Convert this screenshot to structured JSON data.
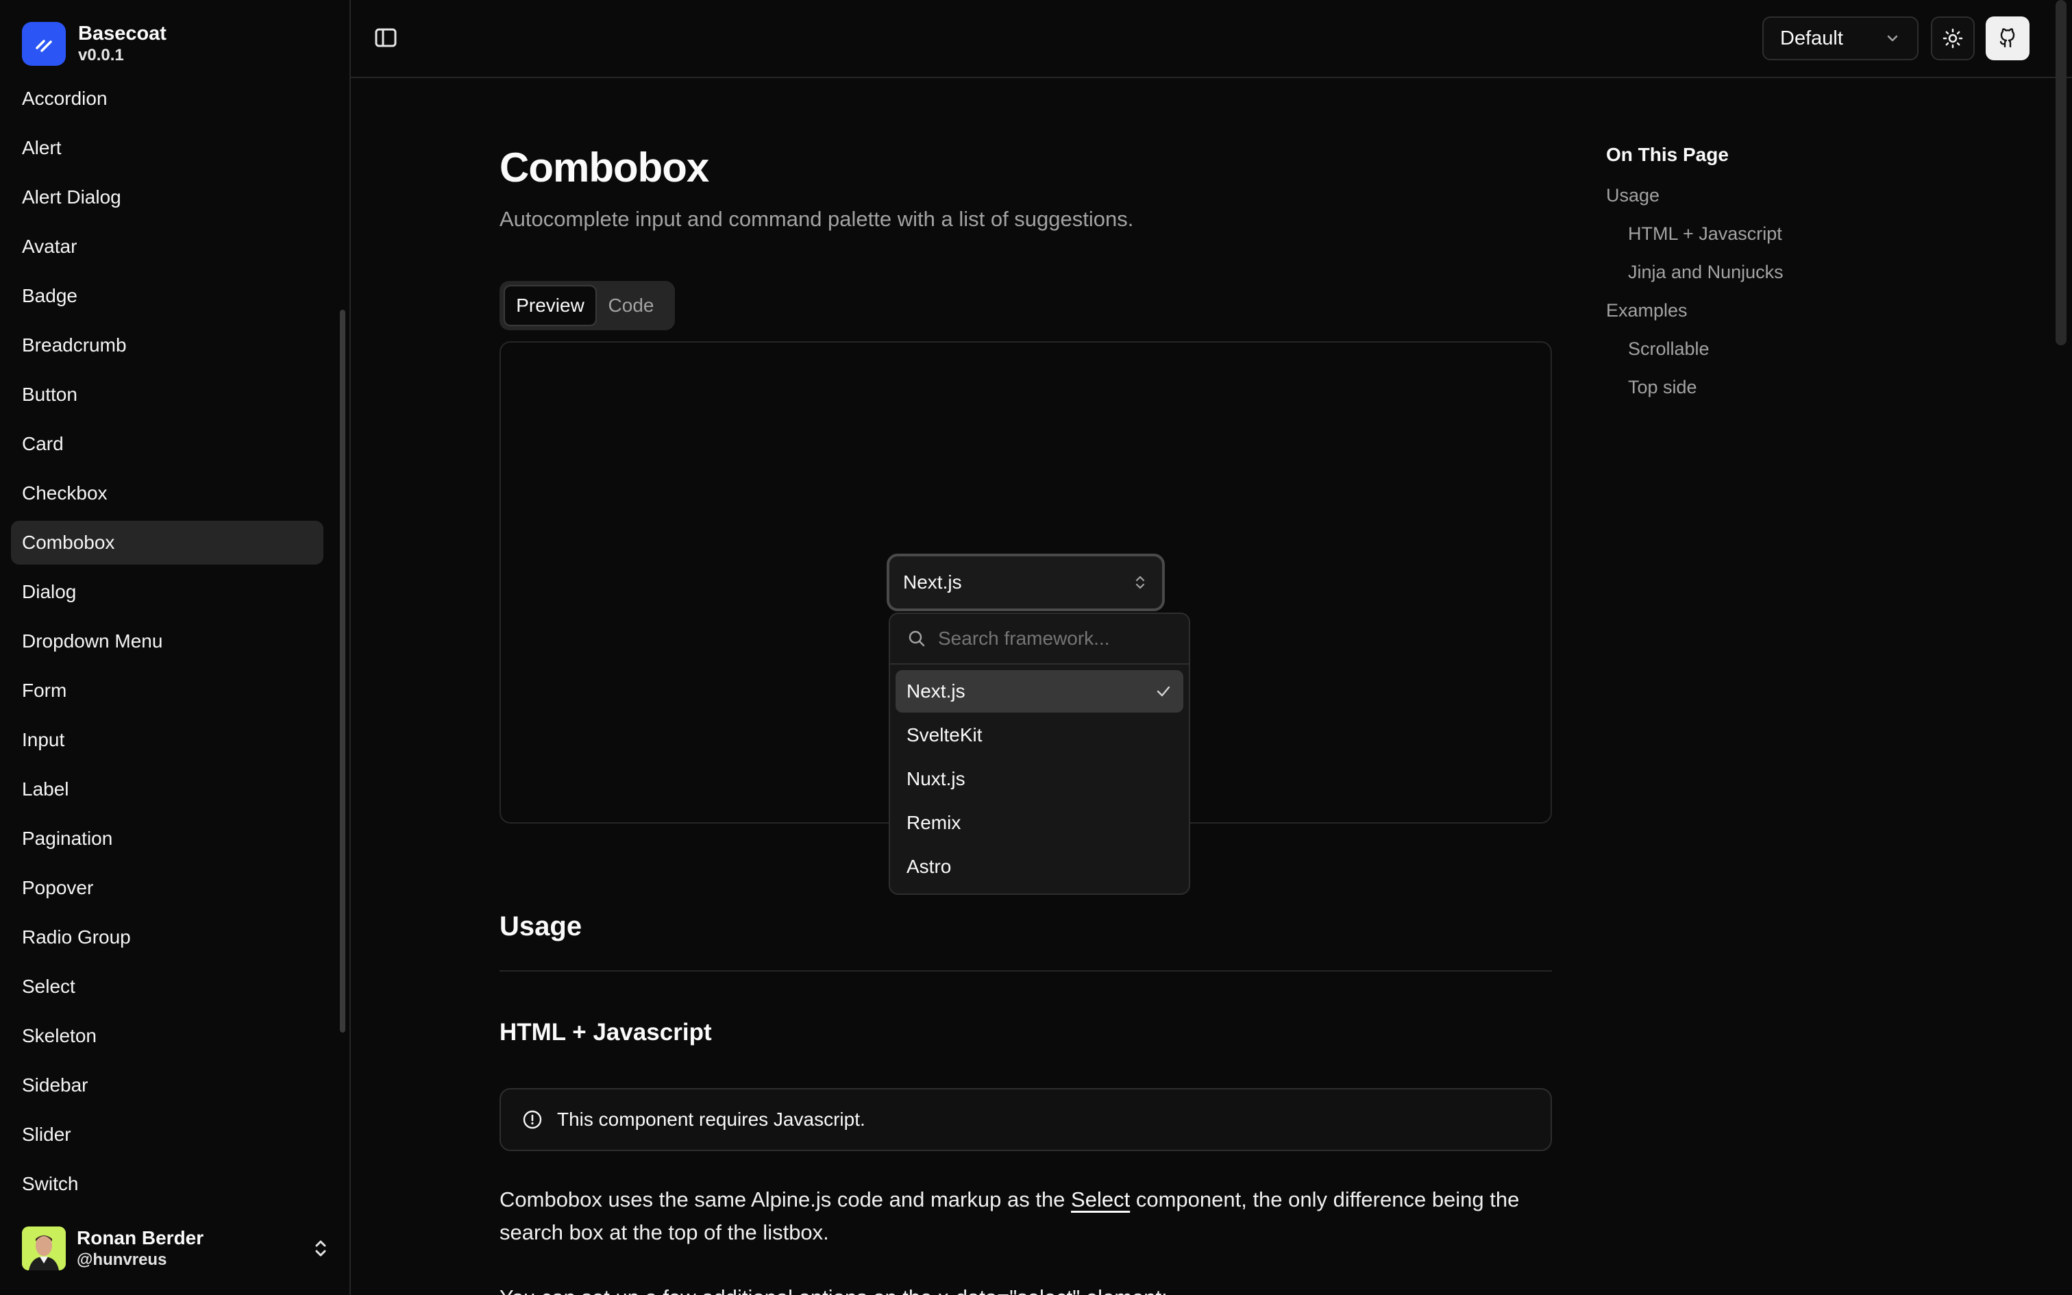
{
  "brand": {
    "name": "Basecoat",
    "version": "v0.0.1"
  },
  "sidebar": {
    "items": [
      {
        "label": "Accordion"
      },
      {
        "label": "Alert"
      },
      {
        "label": "Alert Dialog"
      },
      {
        "label": "Avatar"
      },
      {
        "label": "Badge"
      },
      {
        "label": "Breadcrumb"
      },
      {
        "label": "Button"
      },
      {
        "label": "Card"
      },
      {
        "label": "Checkbox"
      },
      {
        "label": "Combobox",
        "active": true
      },
      {
        "label": "Dialog"
      },
      {
        "label": "Dropdown Menu"
      },
      {
        "label": "Form"
      },
      {
        "label": "Input"
      },
      {
        "label": "Label"
      },
      {
        "label": "Pagination"
      },
      {
        "label": "Popover"
      },
      {
        "label": "Radio Group"
      },
      {
        "label": "Select"
      },
      {
        "label": "Skeleton"
      },
      {
        "label": "Sidebar"
      },
      {
        "label": "Slider"
      },
      {
        "label": "Switch"
      }
    ]
  },
  "user": {
    "name": "Ronan Berder",
    "handle": "@hunvreus"
  },
  "header": {
    "theme_value": "Default"
  },
  "page": {
    "title": "Combobox",
    "description": "Autocomplete input and command palette with a list of suggestions.",
    "tabs": {
      "preview": "Preview",
      "code": "Code"
    },
    "combobox": {
      "selected": "Next.js",
      "search_placeholder": "Search framework...",
      "options": [
        "Next.js",
        "SvelteKit",
        "Nuxt.js",
        "Remix",
        "Astro"
      ]
    },
    "usage_heading": "Usage",
    "html_js_heading": "HTML + Javascript",
    "alert_text": "This component requires Javascript.",
    "para_before_link": "Combobox uses the same Alpine.js code and markup as the ",
    "para_link": "Select",
    "para_after_link": " component, the only difference being the search box at the top of the listbox.",
    "para2": "You can set up a few additional options on the  x-data=\"select\"  element:"
  },
  "toc": {
    "title": "On This Page",
    "items": [
      "Usage",
      "HTML + Javascript",
      "Jinja and Nunjucks",
      "Examples",
      "Scrollable",
      "Top side"
    ]
  },
  "colors": {
    "accent": "#2b56f5",
    "background": "#0a0a0a",
    "border": "#262626",
    "muted_text": "#a3a3a3"
  }
}
